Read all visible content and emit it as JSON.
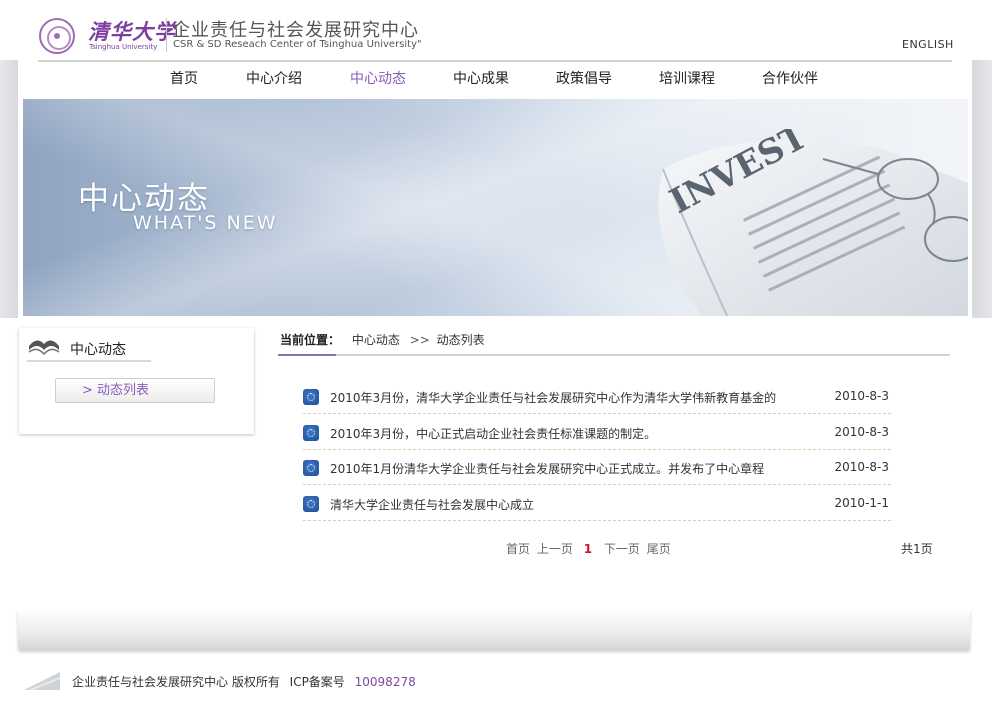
{
  "header": {
    "university_cn": "清华大学",
    "university_en": "Tsinghua University",
    "org_cn": "企业责任与社会发展研究中心",
    "org_en": "CSR & SD Reseach Center of Tsinghua University\"",
    "english_link": "ENGLISH"
  },
  "nav": {
    "items": [
      {
        "label": "首页",
        "active": false
      },
      {
        "label": "中心介绍",
        "active": false
      },
      {
        "label": "中心动态",
        "active": true
      },
      {
        "label": "中心成果",
        "active": false
      },
      {
        "label": "政策倡导",
        "active": false
      },
      {
        "label": "培训课程",
        "active": false
      },
      {
        "label": "合作伙伴",
        "active": false
      }
    ],
    "active_color": "#8a5cb8"
  },
  "banner": {
    "title_cn": "中心动态",
    "title_en": "WHAT'S NEW",
    "newspaper_text": "INVEST"
  },
  "sidebar": {
    "title": "中心动态",
    "button_label": "> 动态列表"
  },
  "breadcrumb": {
    "label": "当前位置：",
    "section": "中心动态",
    "separator": ">>",
    "current": "动态列表"
  },
  "news": [
    {
      "title": "2010年3月份，清华大学企业责任与社会发展研究中心作为清华大学伟新教育基金的",
      "date": "2010-8-3"
    },
    {
      "title": "2010年3月份，中心正式启动企业社会责任标准课题的制定。",
      "date": "2010-8-3"
    },
    {
      "title": "2010年1月份清华大学企业责任与社会发展研究中心正式成立。并发布了中心章程",
      "date": "2010-8-3"
    },
    {
      "title": "清华大学企业责任与社会发展中心成立",
      "date": "2010-1-1"
    }
  ],
  "pagination": {
    "first": "首页",
    "prev": "上一页",
    "current": "1",
    "next": "下一页",
    "last": "尾页",
    "total": "共1页"
  },
  "footer": {
    "copyright": "企业责任与社会发展研究中心  版权所有",
    "icp_label": "ICP备案号",
    "icp_number": "10098278"
  },
  "colors": {
    "brand_purple": "#7e3ea0",
    "link_red": "#c8152f"
  }
}
